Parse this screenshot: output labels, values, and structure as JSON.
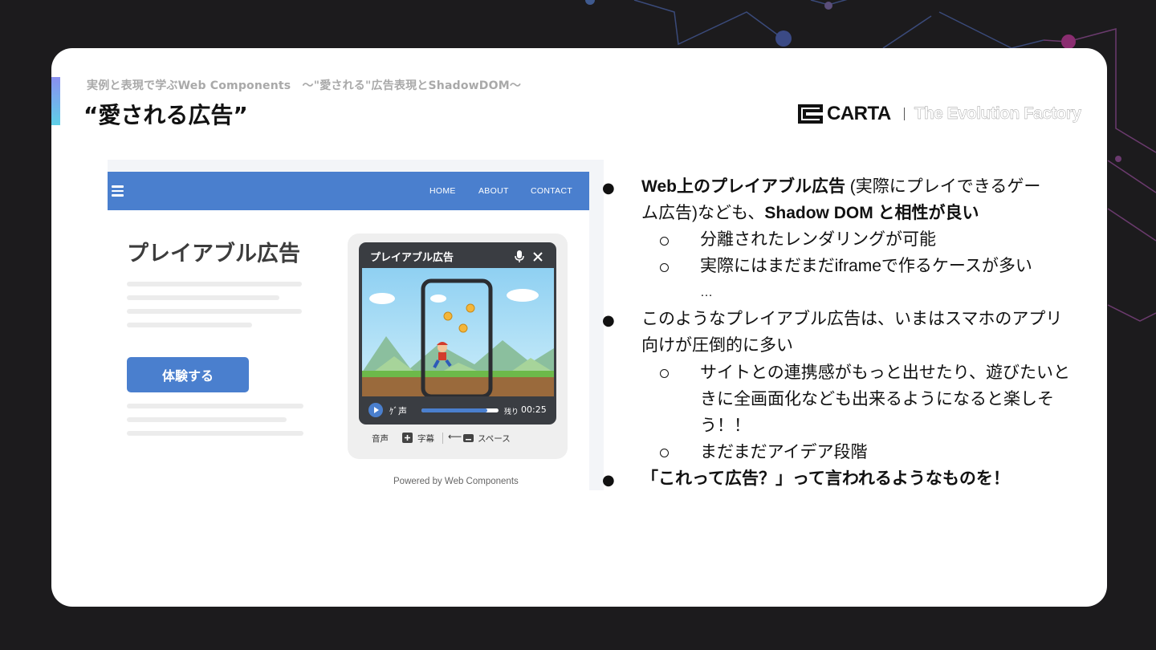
{
  "header": {
    "breadcrumb": "実例と表現で学ぶWeb Components　〜\"愛される\"広告表現とShadowDOM〜",
    "title": "“愛される広告”",
    "brand_name": "CARTA",
    "brand_tagline": "The Evolution Factory"
  },
  "mock_site": {
    "nav": [
      "HOME",
      "ABOUT",
      "CONTACT"
    ],
    "heading": "プレイアブル広告",
    "cta_button": "体験する",
    "ad": {
      "title": "プレイアブル広告",
      "audio_label": "ｹﾞ声",
      "remaining_label": "残り",
      "remaining_time": "00:25",
      "progress": 0.85,
      "footer": [
        "音声",
        "字幕",
        "スペース"
      ]
    },
    "powered_by": "Powered by Web Components"
  },
  "bullets": {
    "b1_bold": "Web上のプレイアブル広告",
    "b1_rest": " (実際にプレイできるゲー",
    "b1_line2_plain": "ム広告)なども、",
    "b1_line2_bold": "Shadow DOM と相性が良い",
    "b1_sub1": "分離されたレンダリングが可能",
    "b1_sub2": "実際にはまだまだiframeで作るケースが多い",
    "b1_sub2_cont": "…",
    "b2_line1": "このようなプレイアブル広告は、いまはスマホのアプリ",
    "b2_line2": "向けが圧倒的に多い",
    "b2_sub1_l1": "サイトとの連携感がもっと出せたり、遊びたいと",
    "b2_sub1_l2": "きに全画面化なども出来るようになると楽しそ",
    "b2_sub1_l3": "う！！",
    "b2_sub2": "まだまだアイデア段階",
    "b3_bold": "「これって広告？」って言われるようなものを！"
  },
  "colors": {
    "background": "#1c1b1d",
    "slide": "#ffffff",
    "nav_blue": "#4a7fce",
    "accent_gradient_top": "#8a8ff0",
    "accent_gradient_bottom": "#5fd0e8"
  }
}
